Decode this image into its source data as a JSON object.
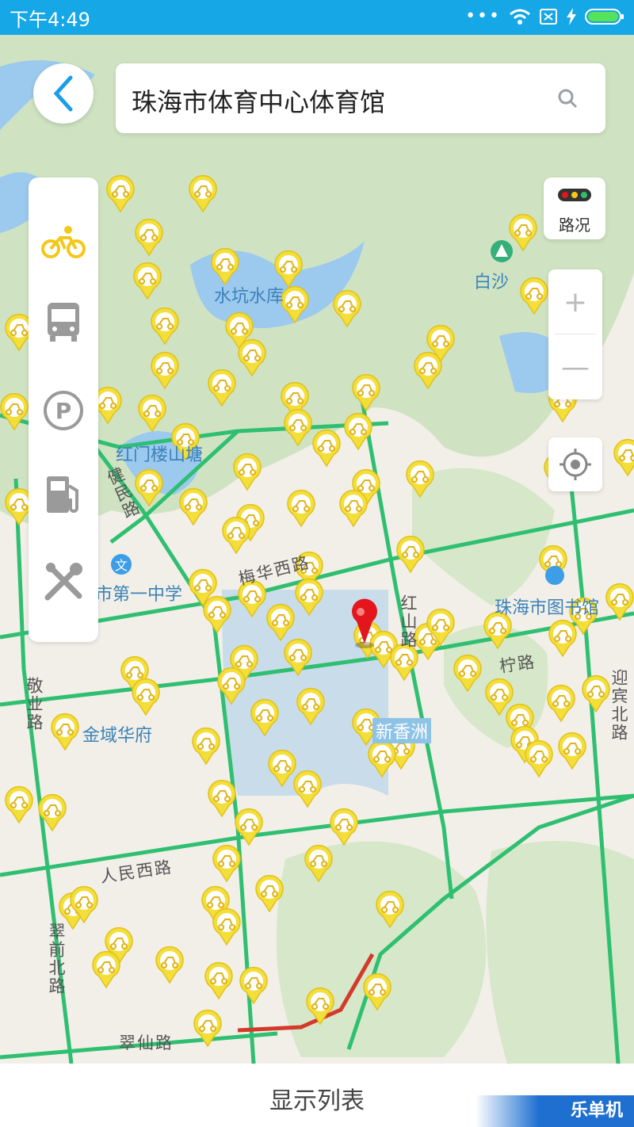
{
  "status_bar": {
    "time": "下午4:49"
  },
  "search": {
    "query": "珠海市体育中心体育馆"
  },
  "side_panel": {
    "items": [
      "bike-icon",
      "bus-icon",
      "parking-icon",
      "gas-station-icon",
      "repair-icon"
    ],
    "active": "bike-icon"
  },
  "traffic_button": {
    "label": "路况"
  },
  "zoom": {
    "in_label": "+",
    "out_label": "—"
  },
  "map_labels": {
    "reservoir": "水坑水库",
    "baisha": "白沙",
    "hongmeilou": "红门楼山塘",
    "school": "市第一中学",
    "library": "珠海市图书馆",
    "jinyu": "金域华府",
    "xinxiangzhou": "新香洲"
  },
  "road_labels": {
    "meihua": "梅华西路",
    "hongshan": "红山路",
    "jianmin": "健民路",
    "jingye": "敬业路",
    "renmin": "人民西路",
    "cuiqian": "翠前北路",
    "cuixian": "翠仙路",
    "yingbin": "迎宾北路",
    "yinghua": "柠路"
  },
  "bottom_bar": {
    "show_list_label": "显示列表"
  },
  "watermark": "乐单机",
  "colors": {
    "accent": "#15a7e6",
    "marker": "#f4de3a",
    "road": "#2fbf71",
    "pin": "#e4161d"
  }
}
